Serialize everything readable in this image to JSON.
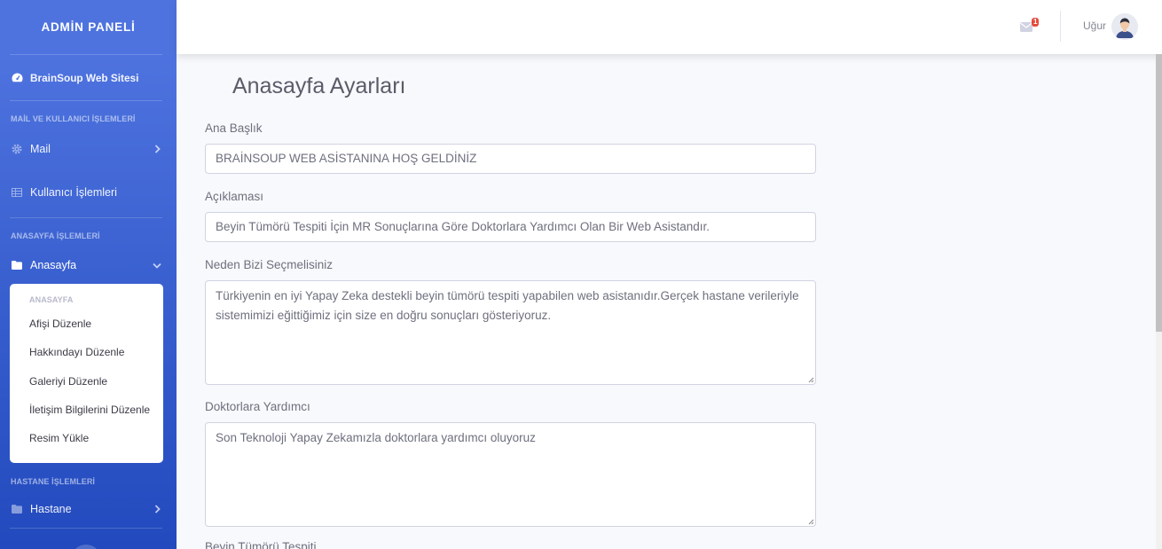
{
  "sidebar": {
    "brand": "ADMİN PANELİ",
    "site_link": "BrainSoup Web Sitesi",
    "heading_mail": "MAİL VE KULLANICI İŞLEMLERİ",
    "mail": "Mail",
    "users": "Kullanıcı İşlemleri",
    "heading_home": "ANASAYFA İŞLEMLERİ",
    "home": "Anasayfa",
    "submenu": {
      "heading": "ANASAYFA",
      "items": [
        "Afişi Düzenle",
        "Hakkındayı Düzenle",
        "Galeriyi Düzenle",
        "İletişim Bilgilerini Düzenle",
        "Resim Yükle"
      ]
    },
    "heading_hospital": "HASTANE İŞLEMLERİ",
    "hospital": "Hastane"
  },
  "topbar": {
    "mail_badge": "1",
    "user_name": "Uğur"
  },
  "main": {
    "title": "Anasayfa Ayarları",
    "fields": [
      {
        "label": "Ana Başlık",
        "value": "BRAİNSOUP WEB ASİSTANINA HOŞ GELDİNİZ"
      },
      {
        "label": "Açıklaması",
        "value": "Beyin Tümörü Tespiti İçin MR Sonuçlarına Göre Doktorlara Yardımcı Olan Bir Web Asistandır."
      },
      {
        "label": "Neden Bizi Seçmelisiniz",
        "value": "Türkiyenin en iyi Yapay Zeka destekli beyin tümörü tespiti yapabilen web asistanıdır.Gerçek hastane verileriyle sistemimizi eğittiğimiz için size en doğru sonuçları gösteriyoruz."
      },
      {
        "label": "Doktorlara Yardımcı",
        "value": "Son Teknoloji Yapay Zekamızla doktorlara yardımcı oluyoruz"
      },
      {
        "label": "Beyin Tümörü Tespiti",
        "value": ""
      }
    ]
  },
  "colors": {
    "sidebar_top": "#4e73df",
    "sidebar_bottom": "#224abe",
    "badge": "#e74a3b"
  }
}
